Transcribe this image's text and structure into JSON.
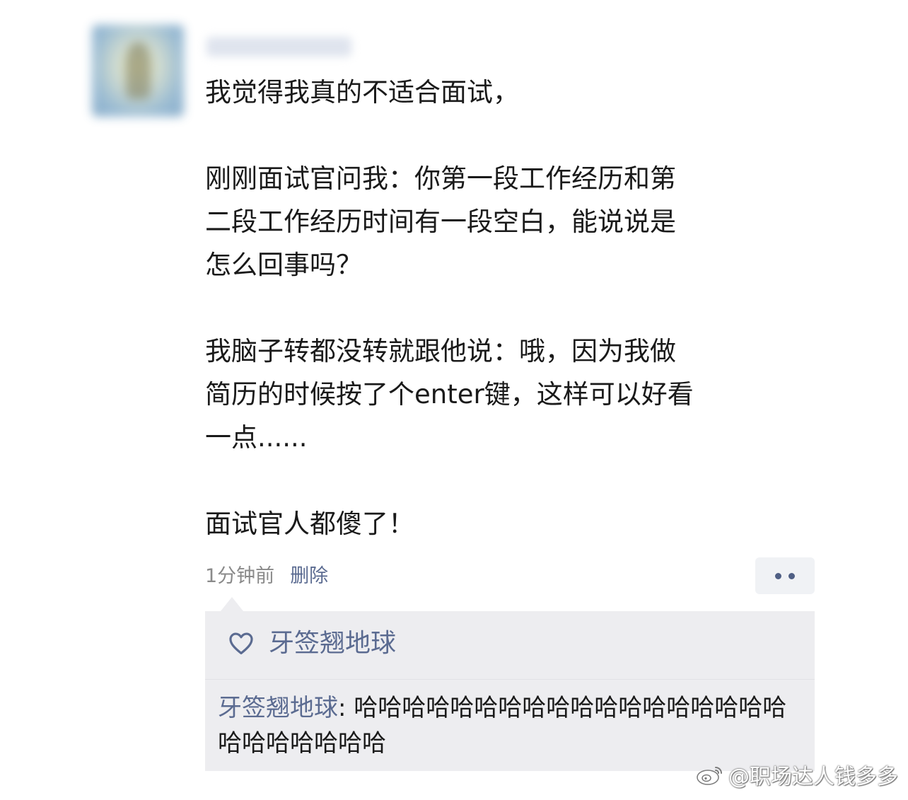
{
  "post": {
    "lines": [
      "我觉得我真的不适合面试，",
      "",
      "刚刚面试官问我：你第一段工作经历和第",
      "二段工作经历时间有一段空白，能说说是",
      "怎么回事吗？",
      "",
      "我脑子转都没转就跟他说：哦，因为我做",
      "简历的时候按了个enter键，这样可以好看",
      "一点......",
      "",
      "面试官人都傻了！"
    ],
    "time": "1分钟前",
    "delete_label": "删除"
  },
  "likes": {
    "icon": "heart-icon",
    "names": "牙签翘地球"
  },
  "comment": {
    "author": "牙签翘地球",
    "separator": ": ",
    "text": "哈哈哈哈哈哈哈哈哈哈哈哈哈哈哈哈哈哈哈哈哈哈哈哈哈"
  },
  "watermark": {
    "icon": "weibo-icon",
    "text": "@职场达人钱多多"
  },
  "colors": {
    "link": "#5b6b91",
    "box_bg": "#ededf0",
    "meta_gray": "#8a8a8a"
  }
}
